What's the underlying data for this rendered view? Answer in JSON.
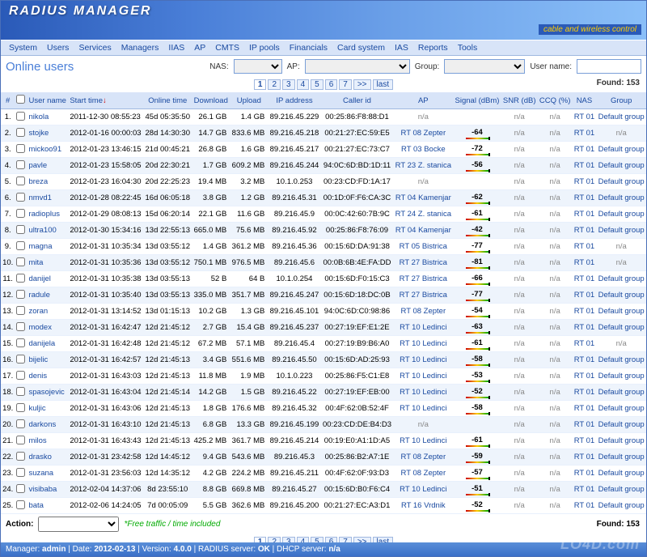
{
  "app": {
    "title": "RADIUS MANAGER",
    "tagline": "cable and wireless control"
  },
  "menu": [
    "System",
    "Users",
    "Services",
    "Managers",
    "IIAS",
    "AP",
    "CMTS",
    "IP pools",
    "Financials",
    "Card system",
    "IAS",
    "Reports",
    "Tools"
  ],
  "page_title": "Online users",
  "filters": {
    "nas_label": "NAS:",
    "ap_label": "AP:",
    "group_label": "Group:",
    "user_label": "User name:",
    "nas_value": "",
    "ap_value": "",
    "group_value": "",
    "user_value": ""
  },
  "found_label": "Found:",
  "found_count": "153",
  "pages": [
    "1",
    "2",
    "3",
    "4",
    "5",
    "6",
    "7",
    ">>",
    "last"
  ],
  "columns": [
    "#",
    "",
    "User name",
    "Start time",
    "Online time",
    "Download",
    "Upload",
    "IP address",
    "Caller id",
    "AP",
    "Signal (dBm)",
    "SNR (dB)",
    "CCQ (%)",
    "NAS",
    "Group"
  ],
  "sort_col": "Start time",
  "sort_dir": "↓",
  "action_label": "Action:",
  "action_value": "",
  "free_note": "*Free traffic / time included",
  "status": {
    "manager_lbl": "Manager:",
    "manager": "admin",
    "date_lbl": "Date:",
    "date": "2012-02-13",
    "ver_lbl": "Version:",
    "ver": "4.0.0",
    "rad_lbl": "RADIUS server:",
    "rad": "OK",
    "dhcp_lbl": "DHCP server:",
    "dhcp": "n/a"
  },
  "watermark": "LO4D.com",
  "rows": [
    {
      "n": "1.",
      "u": "nikola",
      "st": "2011-12-30 08:55:23",
      "ot": "45d 05:35:50",
      "dl": "26.1 GB",
      "ul": "1.4 GB",
      "ip": "89.216.45.229",
      "cid": "00:25:86:F8:88:D1",
      "ap": "n/a",
      "sig": "",
      "snr": "n/a",
      "ccq": "n/a",
      "nas": "RT 01",
      "grp": "Default group"
    },
    {
      "n": "2.",
      "u": "stojke",
      "st": "2012-01-16 00:00:03",
      "ot": "28d 14:30:30",
      "dl": "14.7 GB",
      "ul": "833.6 MB",
      "ip": "89.216.45.218",
      "cid": "00:21:27:EC:59:E5",
      "ap": "RT 08 Zepter",
      "sig": "-64",
      "snr": "n/a",
      "ccq": "n/a",
      "nas": "RT 01",
      "grp": "n/a"
    },
    {
      "n": "3.",
      "u": "mickoo91",
      "st": "2012-01-23 13:46:15",
      "ot": "21d 00:45:21",
      "dl": "26.8 GB",
      "ul": "1.6 GB",
      "ip": "89.216.45.217",
      "cid": "00:21:27:EC:73:C7",
      "ap": "RT 03 Bocke",
      "sig": "-72",
      "snr": "n/a",
      "ccq": "n/a",
      "nas": "RT 01",
      "grp": "Default group"
    },
    {
      "n": "4.",
      "u": "pavle",
      "st": "2012-01-23 15:58:05",
      "ot": "20d 22:30:21",
      "dl": "1.7 GB",
      "ul": "609.2 MB",
      "ip": "89.216.45.244",
      "cid": "94:0C:6D:BD:1D:11",
      "ap": "RT 23 Z. stanica",
      "sig": "-56",
      "snr": "n/a",
      "ccq": "n/a",
      "nas": "RT 01",
      "grp": "Default group"
    },
    {
      "n": "5.",
      "u": "breza",
      "st": "2012-01-23 16:04:30",
      "ot": "20d 22:25:23",
      "dl": "19.4 MB",
      "ul": "3.2 MB",
      "ip": "10.1.0.253",
      "cid": "00:23:CD:FD:1A:17",
      "ap": "n/a",
      "sig": "",
      "snr": "n/a",
      "ccq": "n/a",
      "nas": "RT 01",
      "grp": "Default group"
    },
    {
      "n": "6.",
      "u": "nmvd1",
      "st": "2012-01-28 08:22:45",
      "ot": "16d 06:05:18",
      "dl": "3.8 GB",
      "ul": "1.2 GB",
      "ip": "89.216.45.31",
      "cid": "00:1D:0F:F6:CA:3C",
      "ap": "RT 04 Kamenjar",
      "sig": "-62",
      "snr": "n/a",
      "ccq": "n/a",
      "nas": "RT 01",
      "grp": "Default group"
    },
    {
      "n": "7.",
      "u": "radioplus",
      "st": "2012-01-29 08:08:13",
      "ot": "15d 06:20:14",
      "dl": "22.1 GB",
      "ul": "11.6 GB",
      "ip": "89.216.45.9",
      "cid": "00:0C:42:60:7B:9C",
      "ap": "RT 24 Z. stanica",
      "sig": "-61",
      "snr": "n/a",
      "ccq": "n/a",
      "nas": "RT 01",
      "grp": "Default group"
    },
    {
      "n": "8.",
      "u": "ultra100",
      "st": "2012-01-30 15:34:16",
      "ot": "13d 22:55:13",
      "dl": "665.0 MB",
      "ul": "75.6 MB",
      "ip": "89.216.45.92",
      "cid": "00:25:86:F8:76:09",
      "ap": "RT 04 Kamenjar",
      "sig": "-42",
      "snr": "n/a",
      "ccq": "n/a",
      "nas": "RT 01",
      "grp": "Default group"
    },
    {
      "n": "9.",
      "u": "magna",
      "st": "2012-01-31 10:35:34",
      "ot": "13d 03:55:12",
      "dl": "1.4 GB",
      "ul": "361.2 MB",
      "ip": "89.216.45.36",
      "cid": "00:15:6D:DA:91:38",
      "ap": "RT 05 Bistrica",
      "sig": "-77",
      "snr": "n/a",
      "ccq": "n/a",
      "nas": "RT 01",
      "grp": "n/a"
    },
    {
      "n": "10.",
      "u": "mita",
      "st": "2012-01-31 10:35:36",
      "ot": "13d 03:55:12",
      "dl": "750.1 MB",
      "ul": "976.5 MB",
      "ip": "89.216.45.6",
      "cid": "00:0B:6B:4E:FA:DD",
      "ap": "RT 27 Bistrica",
      "sig": "-81",
      "snr": "n/a",
      "ccq": "n/a",
      "nas": "RT 01",
      "grp": "n/a"
    },
    {
      "n": "11.",
      "u": "danijel",
      "st": "2012-01-31 10:35:38",
      "ot": "13d 03:55:13",
      "dl": "52 B",
      "ul": "64 B",
      "ip": "10.1.0.254",
      "cid": "00:15:6D:F0:15:C3",
      "ap": "RT 27 Bistrica",
      "sig": "-66",
      "snr": "n/a",
      "ccq": "n/a",
      "nas": "RT 01",
      "grp": "Default group"
    },
    {
      "n": "12.",
      "u": "radule",
      "st": "2012-01-31 10:35:40",
      "ot": "13d 03:55:13",
      "dl": "335.0 MB",
      "ul": "351.7 MB",
      "ip": "89.216.45.247",
      "cid": "00:15:6D:18:DC:0B",
      "ap": "RT 27 Bistrica",
      "sig": "-77",
      "snr": "n/a",
      "ccq": "n/a",
      "nas": "RT 01",
      "grp": "Default group"
    },
    {
      "n": "13.",
      "u": "zoran",
      "st": "2012-01-31 13:14:52",
      "ot": "13d 01:15:13",
      "dl": "10.2 GB",
      "ul": "1.3 GB",
      "ip": "89.216.45.101",
      "cid": "94:0C:6D:C0:98:86",
      "ap": "RT 08 Zepter",
      "sig": "-54",
      "snr": "n/a",
      "ccq": "n/a",
      "nas": "RT 01",
      "grp": "Default group"
    },
    {
      "n": "14.",
      "u": "modex",
      "st": "2012-01-31 16:42:47",
      "ot": "12d 21:45:12",
      "dl": "2.7 GB",
      "ul": "15.4 GB",
      "ip": "89.216.45.237",
      "cid": "00:27:19:EF:E1:2E",
      "ap": "RT 10 Ledinci",
      "sig": "-63",
      "snr": "n/a",
      "ccq": "n/a",
      "nas": "RT 01",
      "grp": "Default group"
    },
    {
      "n": "15.",
      "u": "danijela",
      "st": "2012-01-31 16:42:48",
      "ot": "12d 21:45:12",
      "dl": "67.2 MB",
      "ul": "57.1 MB",
      "ip": "89.216.45.4",
      "cid": "00:27:19:B9:B6:A0",
      "ap": "RT 10 Ledinci",
      "sig": "-61",
      "snr": "n/a",
      "ccq": "n/a",
      "nas": "RT 01",
      "grp": "n/a"
    },
    {
      "n": "16.",
      "u": "bijelic",
      "st": "2012-01-31 16:42:57",
      "ot": "12d 21:45:13",
      "dl": "3.4 GB",
      "ul": "551.6 MB",
      "ip": "89.216.45.50",
      "cid": "00:15:6D:AD:25:93",
      "ap": "RT 10 Ledinci",
      "sig": "-58",
      "snr": "n/a",
      "ccq": "n/a",
      "nas": "RT 01",
      "grp": "Default group"
    },
    {
      "n": "17.",
      "u": "denis",
      "st": "2012-01-31 16:43:03",
      "ot": "12d 21:45:13",
      "dl": "11.8 MB",
      "ul": "1.9 MB",
      "ip": "10.1.0.223",
      "cid": "00:25:86:F5:C1:E8",
      "ap": "RT 10 Ledinci",
      "sig": "-53",
      "snr": "n/a",
      "ccq": "n/a",
      "nas": "RT 01",
      "grp": "Default group"
    },
    {
      "n": "18.",
      "u": "spasojevic",
      "st": "2012-01-31 16:43:04",
      "ot": "12d 21:45:14",
      "dl": "14.2 GB",
      "ul": "1.5 GB",
      "ip": "89.216.45.22",
      "cid": "00:27:19:EF:EB:00",
      "ap": "RT 10 Ledinci",
      "sig": "-52",
      "snr": "n/a",
      "ccq": "n/a",
      "nas": "RT 01",
      "grp": "Default group"
    },
    {
      "n": "19.",
      "u": "kuljic",
      "st": "2012-01-31 16:43:06",
      "ot": "12d 21:45:13",
      "dl": "1.8 GB",
      "ul": "176.6 MB",
      "ip": "89.216.45.32",
      "cid": "00:4F:62:0B:52:4F",
      "ap": "RT 10 Ledinci",
      "sig": "-58",
      "snr": "n/a",
      "ccq": "n/a",
      "nas": "RT 01",
      "grp": "Default group"
    },
    {
      "n": "20.",
      "u": "darkons",
      "st": "2012-01-31 16:43:10",
      "ot": "12d 21:45:13",
      "dl": "6.8 GB",
      "ul": "13.3 GB",
      "ip": "89.216.45.199",
      "cid": "00:23:CD:DE:B4:D3",
      "ap": "n/a",
      "sig": "",
      "snr": "n/a",
      "ccq": "n/a",
      "nas": "RT 01",
      "grp": "Default group"
    },
    {
      "n": "21.",
      "u": "milos",
      "st": "2012-01-31 16:43:43",
      "ot": "12d 21:45:13",
      "dl": "425.2 MB",
      "ul": "361.7 MB",
      "ip": "89.216.45.214",
      "cid": "00:19:E0:A1:1D:A5",
      "ap": "RT 10 Ledinci",
      "sig": "-61",
      "snr": "n/a",
      "ccq": "n/a",
      "nas": "RT 01",
      "grp": "Default group"
    },
    {
      "n": "22.",
      "u": "drasko",
      "st": "2012-01-31 23:42:58",
      "ot": "12d 14:45:12",
      "dl": "9.4 GB",
      "ul": "543.6 MB",
      "ip": "89.216.45.3",
      "cid": "00:25:86:B2:A7:1E",
      "ap": "RT 08 Zepter",
      "sig": "-59",
      "snr": "n/a",
      "ccq": "n/a",
      "nas": "RT 01",
      "grp": "Default group"
    },
    {
      "n": "23.",
      "u": "suzana",
      "st": "2012-01-31 23:56:03",
      "ot": "12d 14:35:12",
      "dl": "4.2 GB",
      "ul": "224.2 MB",
      "ip": "89.216.45.211",
      "cid": "00:4F:62:0F:93:D3",
      "ap": "RT 08 Zepter",
      "sig": "-57",
      "snr": "n/a",
      "ccq": "n/a",
      "nas": "RT 01",
      "grp": "Default group"
    },
    {
      "n": "24.",
      "u": "visibaba",
      "st": "2012-02-04 14:37:06",
      "ot": "8d 23:55:10",
      "dl": "8.8 GB",
      "ul": "669.8 MB",
      "ip": "89.216.45.27",
      "cid": "00:15:6D:B0:F6:C4",
      "ap": "RT 10 Ledinci",
      "sig": "-51",
      "snr": "n/a",
      "ccq": "n/a",
      "nas": "RT 01",
      "grp": "Default group"
    },
    {
      "n": "25.",
      "u": "bata",
      "st": "2012-02-06 14:24:05",
      "ot": "7d 00:05:09",
      "dl": "5.5 GB",
      "ul": "362.6 MB",
      "ip": "89.216.45.200",
      "cid": "00:21:27:EC:A3:D1",
      "ap": "RT 16 Vrdnik",
      "sig": "-52",
      "snr": "n/a",
      "ccq": "n/a",
      "nas": "RT 01",
      "grp": "Default group"
    }
  ]
}
